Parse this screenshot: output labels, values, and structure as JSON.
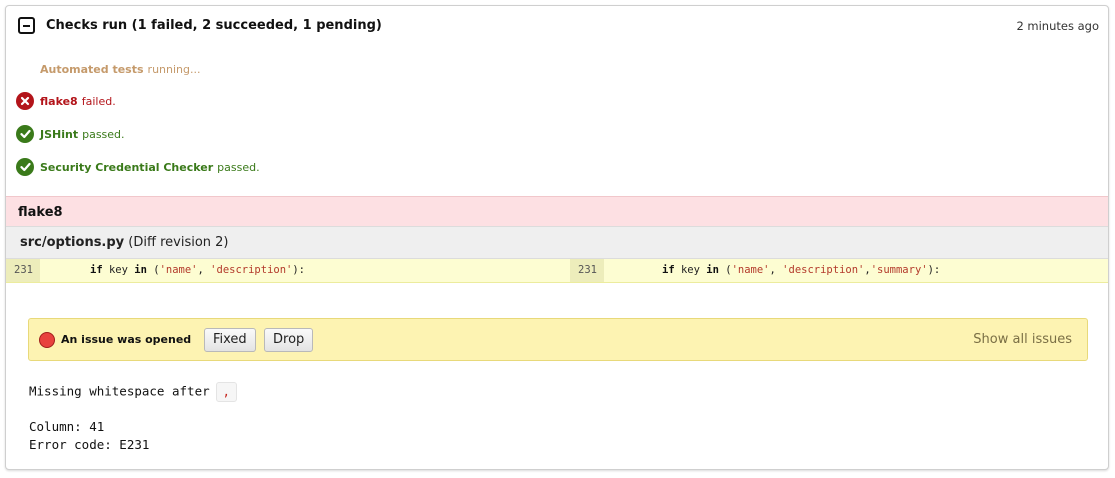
{
  "header": {
    "title": "Checks run (1 failed, 2 succeeded, 1 pending)",
    "time": "2 minutes ago"
  },
  "checks": [
    {
      "name": "Automated tests",
      "status_text": "running...",
      "status": "pending"
    },
    {
      "name": "flake8",
      "status_text": "failed.",
      "status": "failed"
    },
    {
      "name": "JSHint",
      "status_text": "passed.",
      "status": "passed"
    },
    {
      "name": "Security Credential Checker",
      "status_text": "passed.",
      "status": "passed"
    }
  ],
  "tool": {
    "name": "flake8"
  },
  "file": {
    "path": "src/options.py",
    "revision": "(Diff revision 2)"
  },
  "diff": {
    "left": {
      "line": "231",
      "kw_if": "if",
      "ident": " key ",
      "kw_in": "in",
      "open": " (",
      "str1": "'name'",
      "sep1": ", ",
      "str2": "'description'",
      "close": "):"
    },
    "right": {
      "line": "231",
      "kw_if": "if",
      "ident": " key ",
      "kw_in": "in",
      "open": " (",
      "str1": "'name'",
      "sep1": ", ",
      "str2": "'description'",
      "sep2": ",",
      "str3": "'summary'",
      "close": "):"
    }
  },
  "issue": {
    "label": "An issue was opened",
    "fixed_button": "Fixed",
    "drop_button": "Drop",
    "show_all": "Show all issues"
  },
  "message": {
    "text": "Missing whitespace after",
    "code": ",",
    "column": "Column: 41",
    "error_code": "Error code: E231"
  },
  "colors": {
    "failed": "#b3141a",
    "passed": "#3a7a1a",
    "pending": "#c59a6b"
  }
}
